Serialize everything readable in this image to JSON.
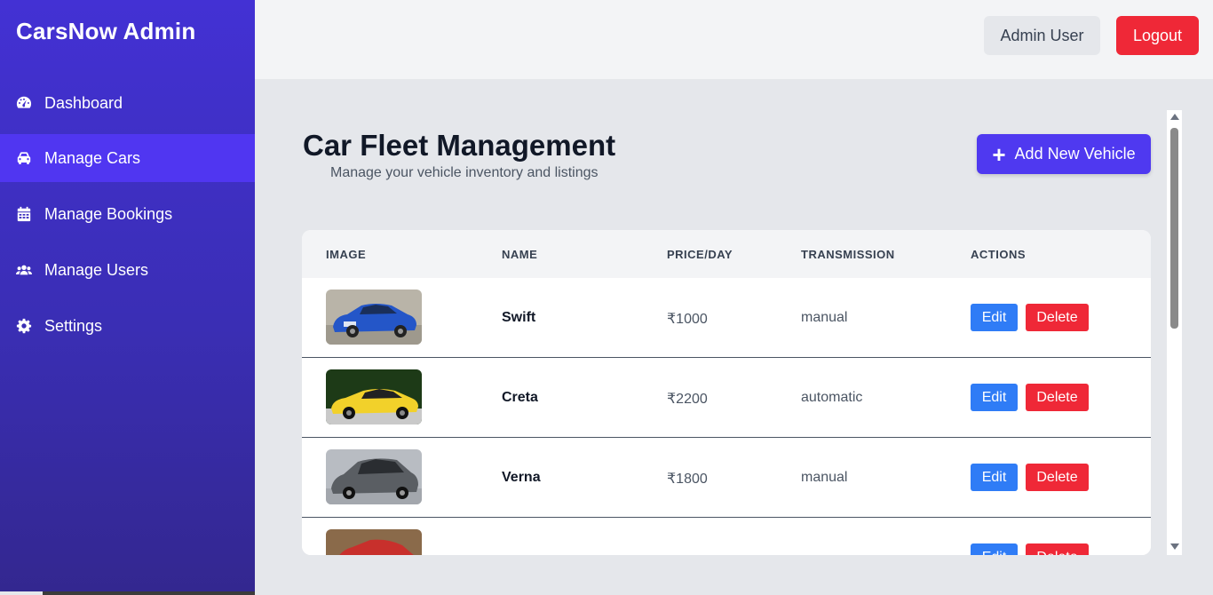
{
  "sidebar": {
    "brand": "CarsNow Admin",
    "items": [
      {
        "label": "Dashboard",
        "icon": "gauge-icon"
      },
      {
        "label": "Manage Cars",
        "icon": "car-icon",
        "active": true
      },
      {
        "label": "Manage Bookings",
        "icon": "calendar-icon"
      },
      {
        "label": "Manage Users",
        "icon": "users-icon"
      },
      {
        "label": "Settings",
        "icon": "gear-icon"
      }
    ]
  },
  "header": {
    "user_label": "Admin User",
    "logout_label": "Logout"
  },
  "main": {
    "title": "Car Fleet Management",
    "subtitle": "Manage your vehicle inventory and listings",
    "add_button_icon": "+",
    "add_button_label": "Add New Vehicle"
  },
  "table": {
    "columns": [
      "IMAGE",
      "NAME",
      "PRICE/DAY",
      "TRANSMISSION",
      "ACTIONS"
    ],
    "rows": [
      {
        "name": "Swift",
        "price": "₹1000",
        "transmission": "manual",
        "edit": "Edit",
        "delete": "Delete",
        "image_color": "#2456c8"
      },
      {
        "name": "Creta",
        "price": "₹2200",
        "transmission": "automatic",
        "edit": "Edit",
        "delete": "Delete",
        "image_color": "#f2d12a"
      },
      {
        "name": "Verna",
        "price": "₹1800",
        "transmission": "manual",
        "edit": "Edit",
        "delete": "Delete",
        "image_color": "#5a5e63"
      },
      {
        "name": "",
        "price": "",
        "transmission": "",
        "edit": "Edit",
        "delete": "Delete",
        "image_color": "#c8302c"
      }
    ]
  },
  "colors": {
    "sidebar_top": "#4331d4",
    "sidebar_bottom": "#33278f",
    "active_item": "#5036f1",
    "primary": "#4f39f0",
    "edit": "#2f7cf6",
    "danger": "#ef2837"
  }
}
